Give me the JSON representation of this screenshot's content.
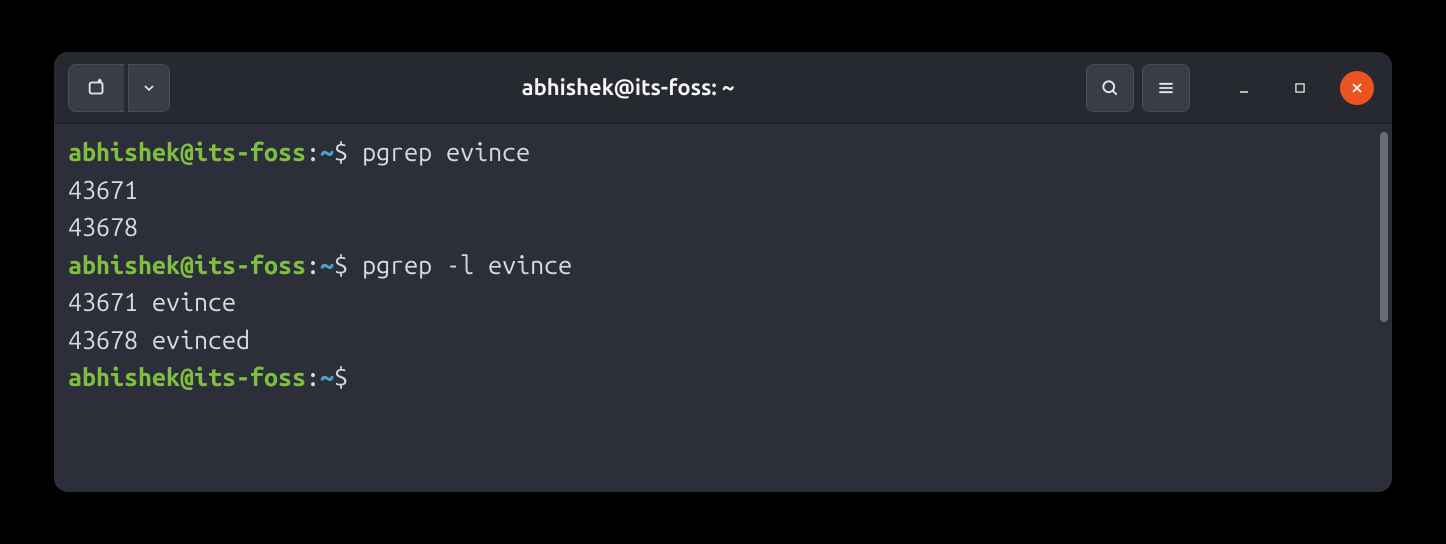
{
  "window": {
    "title": "abhishek@its-foss: ~"
  },
  "prompt": {
    "user_host": "abhishek@its-foss",
    "separator": ":",
    "path": "~",
    "symbol": "$"
  },
  "lines": [
    {
      "type": "cmd",
      "command": " pgrep evince"
    },
    {
      "type": "out",
      "text": "43671"
    },
    {
      "type": "out",
      "text": "43678"
    },
    {
      "type": "cmd",
      "command": " pgrep -l evince"
    },
    {
      "type": "out",
      "text": "43671 evince"
    },
    {
      "type": "out",
      "text": "43678 evinced"
    },
    {
      "type": "cmd",
      "command": " "
    }
  ]
}
